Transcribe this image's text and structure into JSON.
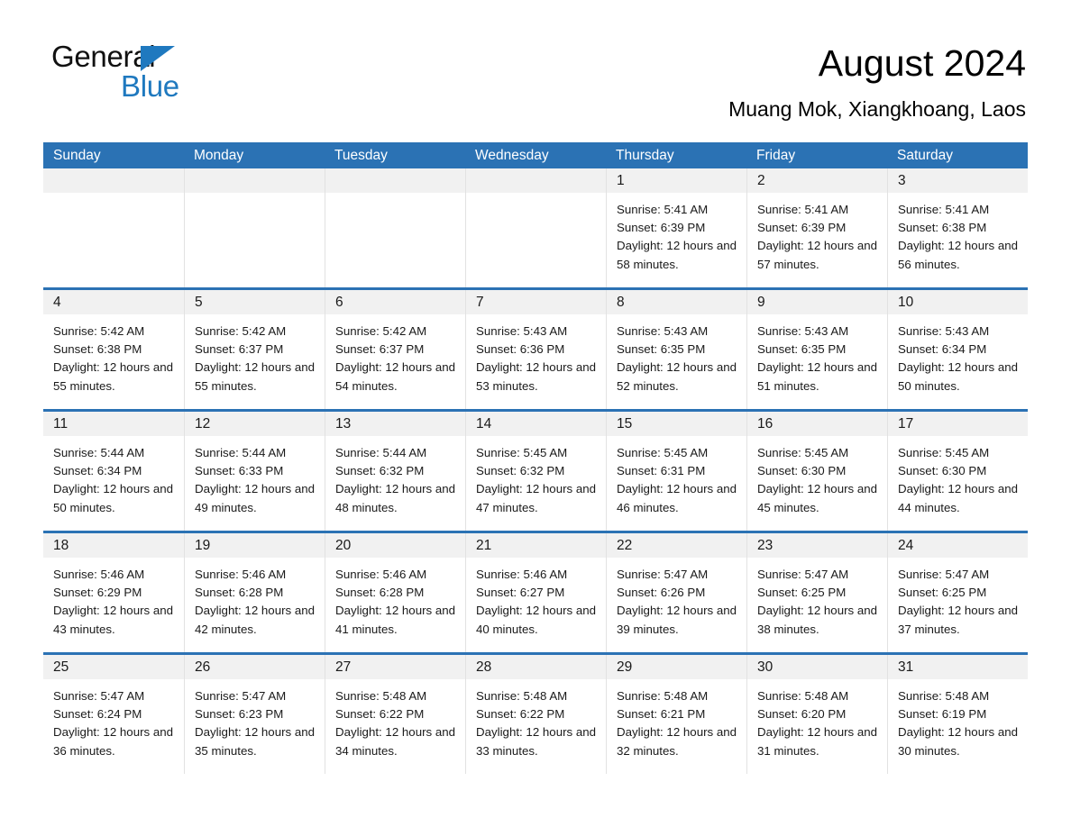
{
  "brand": {
    "name_part1": "General",
    "name_part2": "Blue",
    "triangle_color": "#1F79BF"
  },
  "header": {
    "month_title": "August 2024",
    "location": "Muang Mok, Xiangkhoang, Laos",
    "accent_color": "#2B72B4",
    "daynum_band_color": "#F1F1F1"
  },
  "calendar": {
    "day_headers": [
      "Sunday",
      "Monday",
      "Tuesday",
      "Wednesday",
      "Thursday",
      "Friday",
      "Saturday"
    ],
    "weeks": [
      [
        {
          "day": "",
          "empty": true
        },
        {
          "day": "",
          "empty": true
        },
        {
          "day": "",
          "empty": true
        },
        {
          "day": "",
          "empty": true
        },
        {
          "day": "1",
          "sunrise": "Sunrise: 5:41 AM",
          "sunset": "Sunset: 6:39 PM",
          "daylight": "Daylight: 12 hours and 58 minutes."
        },
        {
          "day": "2",
          "sunrise": "Sunrise: 5:41 AM",
          "sunset": "Sunset: 6:39 PM",
          "daylight": "Daylight: 12 hours and 57 minutes."
        },
        {
          "day": "3",
          "sunrise": "Sunrise: 5:41 AM",
          "sunset": "Sunset: 6:38 PM",
          "daylight": "Daylight: 12 hours and 56 minutes."
        }
      ],
      [
        {
          "day": "4",
          "sunrise": "Sunrise: 5:42 AM",
          "sunset": "Sunset: 6:38 PM",
          "daylight": "Daylight: 12 hours and 55 minutes."
        },
        {
          "day": "5",
          "sunrise": "Sunrise: 5:42 AM",
          "sunset": "Sunset: 6:37 PM",
          "daylight": "Daylight: 12 hours and 55 minutes."
        },
        {
          "day": "6",
          "sunrise": "Sunrise: 5:42 AM",
          "sunset": "Sunset: 6:37 PM",
          "daylight": "Daylight: 12 hours and 54 minutes."
        },
        {
          "day": "7",
          "sunrise": "Sunrise: 5:43 AM",
          "sunset": "Sunset: 6:36 PM",
          "daylight": "Daylight: 12 hours and 53 minutes."
        },
        {
          "day": "8",
          "sunrise": "Sunrise: 5:43 AM",
          "sunset": "Sunset: 6:35 PM",
          "daylight": "Daylight: 12 hours and 52 minutes."
        },
        {
          "day": "9",
          "sunrise": "Sunrise: 5:43 AM",
          "sunset": "Sunset: 6:35 PM",
          "daylight": "Daylight: 12 hours and 51 minutes."
        },
        {
          "day": "10",
          "sunrise": "Sunrise: 5:43 AM",
          "sunset": "Sunset: 6:34 PM",
          "daylight": "Daylight: 12 hours and 50 minutes."
        }
      ],
      [
        {
          "day": "11",
          "sunrise": "Sunrise: 5:44 AM",
          "sunset": "Sunset: 6:34 PM",
          "daylight": "Daylight: 12 hours and 50 minutes."
        },
        {
          "day": "12",
          "sunrise": "Sunrise: 5:44 AM",
          "sunset": "Sunset: 6:33 PM",
          "daylight": "Daylight: 12 hours and 49 minutes."
        },
        {
          "day": "13",
          "sunrise": "Sunrise: 5:44 AM",
          "sunset": "Sunset: 6:32 PM",
          "daylight": "Daylight: 12 hours and 48 minutes."
        },
        {
          "day": "14",
          "sunrise": "Sunrise: 5:45 AM",
          "sunset": "Sunset: 6:32 PM",
          "daylight": "Daylight: 12 hours and 47 minutes."
        },
        {
          "day": "15",
          "sunrise": "Sunrise: 5:45 AM",
          "sunset": "Sunset: 6:31 PM",
          "daylight": "Daylight: 12 hours and 46 minutes."
        },
        {
          "day": "16",
          "sunrise": "Sunrise: 5:45 AM",
          "sunset": "Sunset: 6:30 PM",
          "daylight": "Daylight: 12 hours and 45 minutes."
        },
        {
          "day": "17",
          "sunrise": "Sunrise: 5:45 AM",
          "sunset": "Sunset: 6:30 PM",
          "daylight": "Daylight: 12 hours and 44 minutes."
        }
      ],
      [
        {
          "day": "18",
          "sunrise": "Sunrise: 5:46 AM",
          "sunset": "Sunset: 6:29 PM",
          "daylight": "Daylight: 12 hours and 43 minutes."
        },
        {
          "day": "19",
          "sunrise": "Sunrise: 5:46 AM",
          "sunset": "Sunset: 6:28 PM",
          "daylight": "Daylight: 12 hours and 42 minutes."
        },
        {
          "day": "20",
          "sunrise": "Sunrise: 5:46 AM",
          "sunset": "Sunset: 6:28 PM",
          "daylight": "Daylight: 12 hours and 41 minutes."
        },
        {
          "day": "21",
          "sunrise": "Sunrise: 5:46 AM",
          "sunset": "Sunset: 6:27 PM",
          "daylight": "Daylight: 12 hours and 40 minutes."
        },
        {
          "day": "22",
          "sunrise": "Sunrise: 5:47 AM",
          "sunset": "Sunset: 6:26 PM",
          "daylight": "Daylight: 12 hours and 39 minutes."
        },
        {
          "day": "23",
          "sunrise": "Sunrise: 5:47 AM",
          "sunset": "Sunset: 6:25 PM",
          "daylight": "Daylight: 12 hours and 38 minutes."
        },
        {
          "day": "24",
          "sunrise": "Sunrise: 5:47 AM",
          "sunset": "Sunset: 6:25 PM",
          "daylight": "Daylight: 12 hours and 37 minutes."
        }
      ],
      [
        {
          "day": "25",
          "sunrise": "Sunrise: 5:47 AM",
          "sunset": "Sunset: 6:24 PM",
          "daylight": "Daylight: 12 hours and 36 minutes."
        },
        {
          "day": "26",
          "sunrise": "Sunrise: 5:47 AM",
          "sunset": "Sunset: 6:23 PM",
          "daylight": "Daylight: 12 hours and 35 minutes."
        },
        {
          "day": "27",
          "sunrise": "Sunrise: 5:48 AM",
          "sunset": "Sunset: 6:22 PM",
          "daylight": "Daylight: 12 hours and 34 minutes."
        },
        {
          "day": "28",
          "sunrise": "Sunrise: 5:48 AM",
          "sunset": "Sunset: 6:22 PM",
          "daylight": "Daylight: 12 hours and 33 minutes."
        },
        {
          "day": "29",
          "sunrise": "Sunrise: 5:48 AM",
          "sunset": "Sunset: 6:21 PM",
          "daylight": "Daylight: 12 hours and 32 minutes."
        },
        {
          "day": "30",
          "sunrise": "Sunrise: 5:48 AM",
          "sunset": "Sunset: 6:20 PM",
          "daylight": "Daylight: 12 hours and 31 minutes."
        },
        {
          "day": "31",
          "sunrise": "Sunrise: 5:48 AM",
          "sunset": "Sunset: 6:19 PM",
          "daylight": "Daylight: 12 hours and 30 minutes."
        }
      ]
    ]
  }
}
